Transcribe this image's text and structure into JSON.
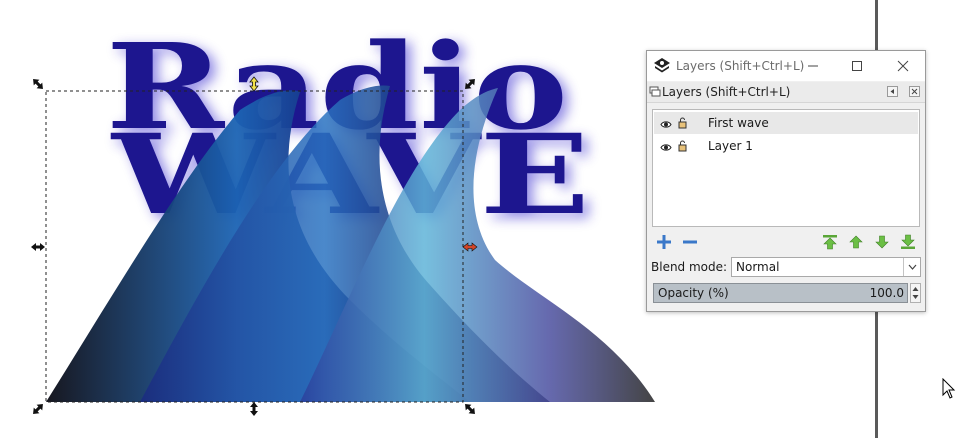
{
  "canvas": {
    "word_top": "Radio",
    "word_bottom": "WAVE",
    "text_color": "#1d168f"
  },
  "dialog": {
    "title": "Layers (Shift+Ctrl+L)",
    "dock_title": "Layers (Shift+Ctrl+L)",
    "layers": [
      {
        "name": "First wave",
        "selected": true
      },
      {
        "name": "Layer 1",
        "selected": false
      }
    ],
    "blend_mode_label": "Blend mode:",
    "blend_mode_value": "Normal",
    "opacity_label": "Opacity (%)",
    "opacity_value": "100.0",
    "opacity_fraction": 1.0
  },
  "icons": {
    "app": "inkscape-layers-icon",
    "minimize": "minimize-icon",
    "maximize": "maximize-icon",
    "close": "close-icon",
    "add_layer": "plus-icon",
    "remove_layer": "minus-icon",
    "raise_top": "arrow-top-icon",
    "raise": "arrow-up-icon",
    "lower": "arrow-down-icon",
    "lower_bottom": "arrow-bottom-icon",
    "visibility": "eye-icon",
    "lock": "lock-icon",
    "cursor": "mouse-pointer-icon"
  }
}
